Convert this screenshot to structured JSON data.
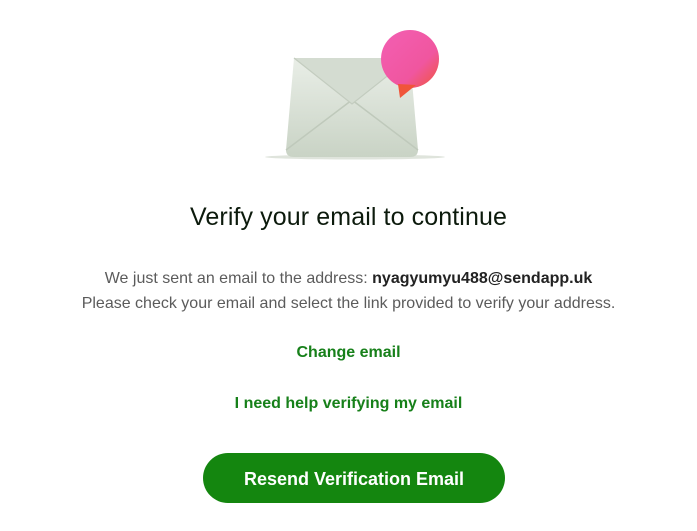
{
  "illustration": {
    "icon": "envelope-with-notification-bubble",
    "envelope_color": "#dfe6dc",
    "bubble_color": "#f0569f"
  },
  "heading": "Verify your email to continue",
  "message": {
    "line1_prefix": "We just sent an email to the address: ",
    "email": "nyagyumyu488@sendapp.uk",
    "line2": "Please check your email and select the link provided to verify your address."
  },
  "links": {
    "change_email": "Change email",
    "help_verify": "I need help verifying my email"
  },
  "resend_button": {
    "label": "Resend Verification Email",
    "color": "#14860f"
  },
  "colors": {
    "link": "#17801a",
    "heading": "#0c1a0c",
    "body_text": "#5b5b5b"
  }
}
